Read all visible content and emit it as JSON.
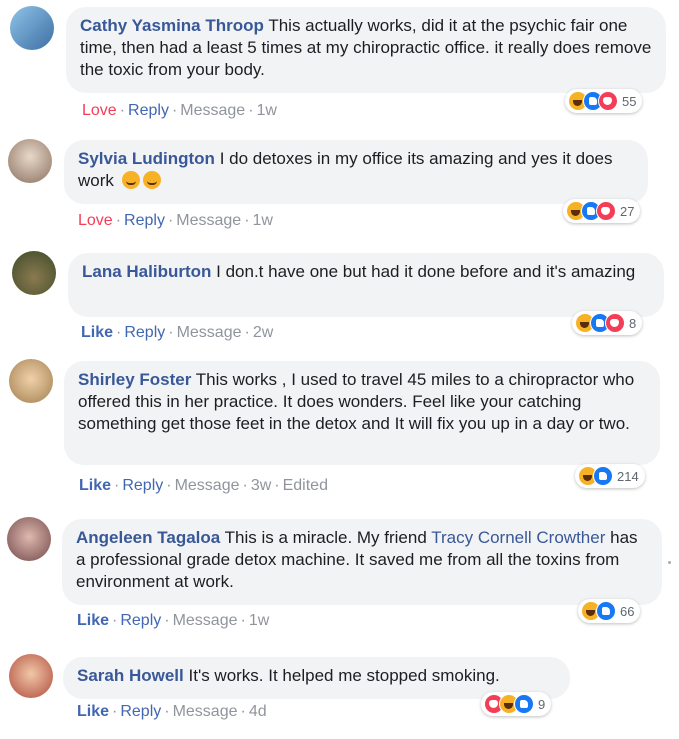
{
  "comments": [
    {
      "author": "Cathy Yasmina Throop",
      "text": "This actually works, did it at the psychic fair one time, then had a least 5 times at my chiropractic office. it really does remove the toxic from your body.",
      "reaction_label": "Love",
      "reply": "Reply",
      "message": "Message",
      "time": "1w",
      "reaction_count": "55",
      "avatar_color": "#5b8fbf"
    },
    {
      "author": "Sylvia Ludington",
      "text": "I do detoxes in my office its amazing and yes it does work",
      "reaction_label": "Love",
      "reply": "Reply",
      "message": "Message",
      "time": "1w",
      "reaction_count": "27",
      "avatar_color": "#b39a88"
    },
    {
      "author": "Lana Haliburton",
      "text": "I don.t have one but had it done before and it's amazing",
      "reaction_label": "Like",
      "reply": "Reply",
      "message": "Message",
      "time": "2w",
      "reaction_count": "8",
      "avatar_color": "#5a6b3c"
    },
    {
      "author": "Shirley Foster",
      "text": "This works , I used to travel 45 miles to a chiropractor who offered this in her practice. It does wonders. Feel like your catching something get those feet in the detox and It will fix you up in a day or two.",
      "reaction_label": "Like",
      "reply": "Reply",
      "message": "Message",
      "time": "3w",
      "edited": "Edited",
      "reaction_count": "214",
      "avatar_color": "#c9a878"
    },
    {
      "author": "Angeleen Tagaloa",
      "text_before": "This is a miracle. My friend",
      "mention": "Tracy Cornell Crowther",
      "text_after": "has a professional grade detox machine. It saved me from all the toxins from environment at work.",
      "reaction_label": "Like",
      "reply": "Reply",
      "message": "Message",
      "time": "1w",
      "reaction_count": "66",
      "avatar_color": "#a07070"
    },
    {
      "author": "Sarah Howell",
      "text": "It's works. It helped me stopped smoking.",
      "reaction_label": "Like",
      "reply": "Reply",
      "message": "Message",
      "time": "4d",
      "reaction_count": "9",
      "avatar_color": "#b04a3a"
    }
  ]
}
